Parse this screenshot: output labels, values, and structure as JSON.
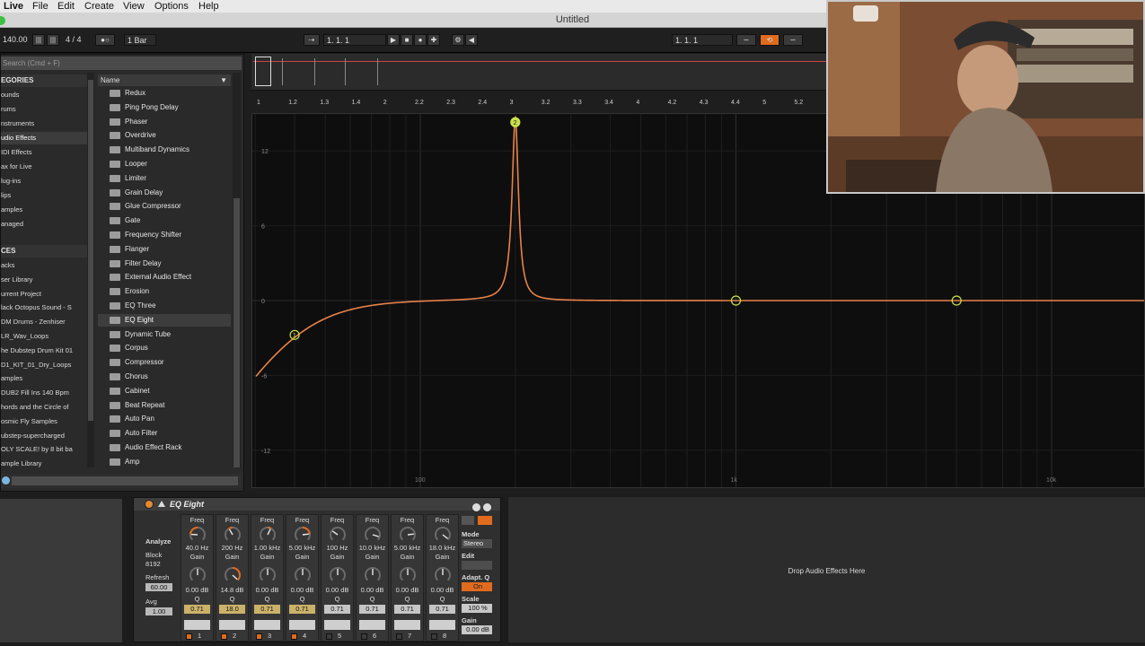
{
  "menubar": {
    "app": "Live",
    "items": [
      "File",
      "Edit",
      "Create",
      "View",
      "Options",
      "Help"
    ]
  },
  "window": {
    "title": "Untitled"
  },
  "transport": {
    "tempo": "140.00",
    "time_signature": "4 / 4",
    "quantize": "1 Bar",
    "position": "1.   1.   1",
    "loop_position": "1.   1.   1"
  },
  "browser": {
    "search_placeholder": "Search (Cmd + F)",
    "categories_header": "EGORIES",
    "categories": [
      "ounds",
      "rums",
      "nstruments",
      "udio Effects",
      "IDI Effects",
      "ax for Live",
      "lug-ins",
      "lips",
      "amples",
      "anaged"
    ],
    "selected_category_index": 3,
    "places_header": "CES",
    "places": [
      "acks",
      "ser Library",
      "urrent Project",
      "lack Octopus Sound - S",
      "DM Drums - Zenhiser",
      "LR_Wav_Loops",
      "he Dubstep Drum Kit 01",
      "D1_KIT_01_Dry_Loops",
      "amples",
      "DUB2 Fill Ins 140 Bpm",
      "hords and the Circle of",
      "osmic Fly Samples",
      "ubstep-supercharged",
      "OLY SCALE! by 8 bit ba",
      "ample Library"
    ],
    "name_header": "Name",
    "items": [
      "Redux",
      "Ping Pong Delay",
      "Phaser",
      "Overdrive",
      "Multiband Dynamics",
      "Looper",
      "Limiter",
      "Grain Delay",
      "Glue Compressor",
      "Gate",
      "Frequency Shifter",
      "Flanger",
      "Filter Delay",
      "External Audio Effect",
      "Erosion",
      "EQ Three",
      "EQ Eight",
      "Dynamic Tube",
      "Corpus",
      "Compressor",
      "Chorus",
      "Cabinet",
      "Beat Repeat",
      "Auto Pan",
      "Auto Filter",
      "Audio Effect Rack",
      "Amp"
    ],
    "selected_item_index": 16
  },
  "ruler": {
    "ticks": [
      "1",
      "1.2",
      "1.3",
      "1.4",
      "2",
      "2.2",
      "2.3",
      "2.4",
      "3",
      "3.2",
      "3.3",
      "3.4",
      "4",
      "4.2",
      "4.3",
      "4.4",
      "5",
      "5.2"
    ]
  },
  "eq_display": {
    "y_labels": [
      "12",
      "6",
      "0",
      "-6",
      "-12"
    ],
    "x_labels": [
      "100",
      "1k",
      "10k"
    ],
    "band_markers": [
      "1",
      "2"
    ]
  },
  "device": {
    "title": "EQ Eight",
    "analyze_label": "Analyze",
    "block_label": "Block",
    "block_value": "8192",
    "refresh_label": "Refresh",
    "refresh_value": "60.00",
    "avg_label": "Avg",
    "avg_value": "1.00",
    "freq_label": "Freq",
    "gain_label": "Gain",
    "q_label": "Q",
    "bands": [
      {
        "num": "1",
        "freq": "40.0 Hz",
        "gain": "0.00 dB",
        "q": "0.71",
        "on": true
      },
      {
        "num": "2",
        "freq": "200 Hz",
        "gain": "14.8 dB",
        "q": "18.0",
        "on": true
      },
      {
        "num": "3",
        "freq": "1.00 kHz",
        "gain": "0.00 dB",
        "q": "0.71",
        "on": true
      },
      {
        "num": "4",
        "freq": "5.00 kHz",
        "gain": "0.00 dB",
        "q": "0.71",
        "on": true
      },
      {
        "num": "5",
        "freq": "100 Hz",
        "gain": "0.00 dB",
        "q": "0.71",
        "on": false
      },
      {
        "num": "6",
        "freq": "10.0 kHz",
        "gain": "0.00 dB",
        "q": "0.71",
        "on": false
      },
      {
        "num": "7",
        "freq": "5.00 kHz",
        "gain": "0.00 dB",
        "q": "0.71",
        "on": false
      },
      {
        "num": "8",
        "freq": "18.0 kHz",
        "gain": "0.00 dB",
        "q": "0.71",
        "on": false
      }
    ],
    "mode_label": "Mode",
    "mode_value": "Stereo",
    "edit_label": "Edit",
    "adapt_q_label": "Adapt. Q",
    "adapt_q_value": "On",
    "scale_label": "Scale",
    "scale_value": "100 %",
    "gain_out_label": "Gain",
    "gain_out_value": "0.00 dB"
  },
  "dropzone": {
    "text": "Drop Audio Effects Here"
  },
  "colors": {
    "accent": "#e06b1f",
    "curve": "#e8824a",
    "marker": "#c8e04a"
  }
}
